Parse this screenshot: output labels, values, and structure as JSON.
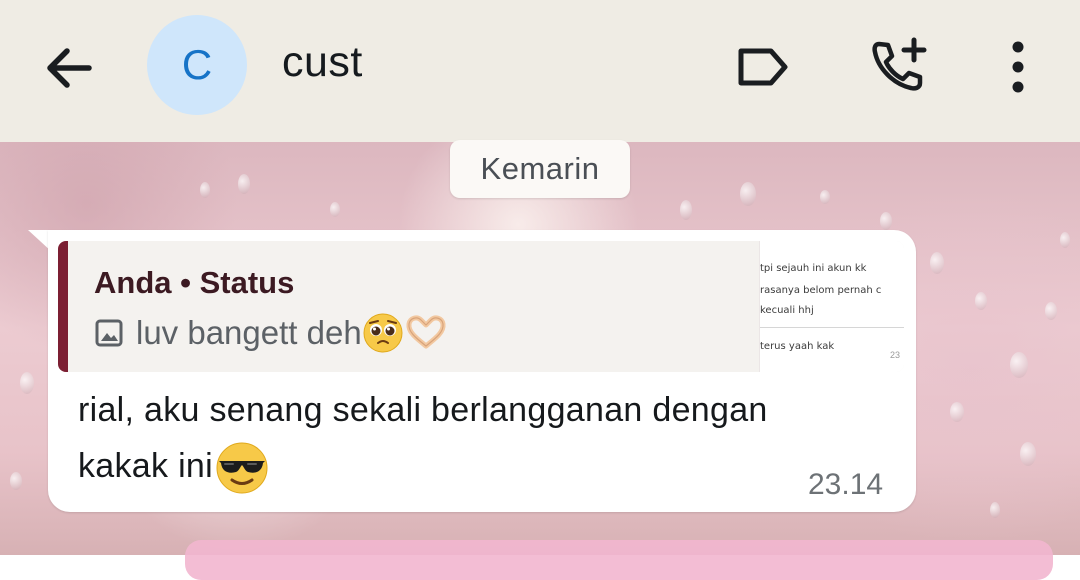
{
  "header": {
    "back_icon": "arrow-left-icon",
    "avatar_letter": "C",
    "contact_name": "cust",
    "label_icon": "label-tag-icon",
    "add_call_icon": "phone-plus-icon",
    "menu_icon": "more-vert-icon"
  },
  "colors": {
    "header_bg": "#efece4",
    "avatar_bg": "#cfe6fb",
    "avatar_fg": "#1673c7",
    "quote_accent": "#7c1f33",
    "bubble_bg": "#ffffff"
  },
  "chat": {
    "date_separator": "Kemarin",
    "message": {
      "quote": {
        "author": "Anda",
        "separator": "•",
        "source": "Status",
        "media_icon": "image-icon",
        "text": "luv bangett deh",
        "emojis": [
          "pleading-face-emoji",
          "heart-hands-emoji"
        ],
        "thumbnail_lines": [
          "tpi sejauh ini akun kk",
          "rasanya belom pernah c",
          "kecuali hhj",
          "terus yaah kak"
        ],
        "thumbnail_time": "23"
      },
      "text_line1": "rial, aku senang sekali berlangganan dengan",
      "text_line2": "kakak ini",
      "trailing_emoji": "smiling-face-with-sunglasses-emoji",
      "time": "23.14"
    }
  }
}
